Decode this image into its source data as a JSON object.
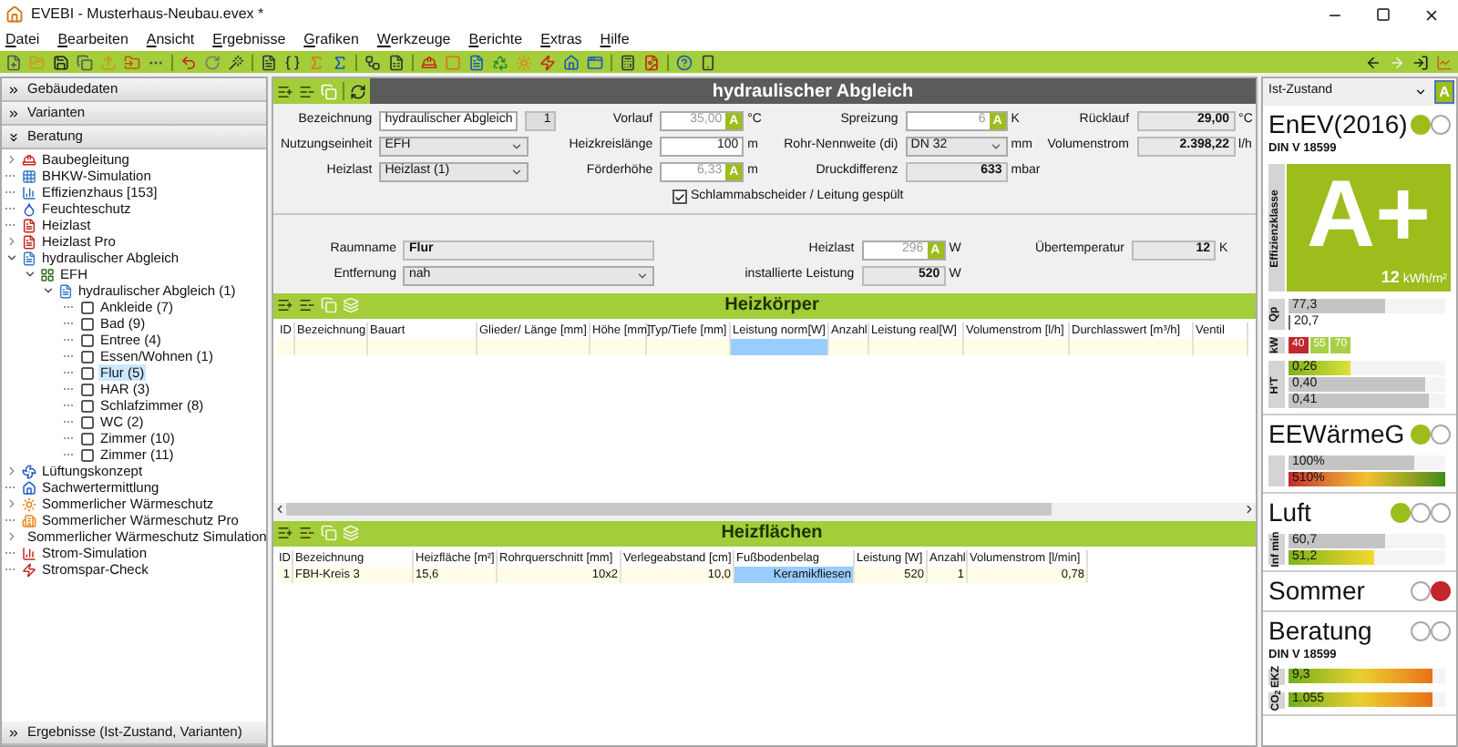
{
  "window": {
    "title": "EVEBI - Musterhaus-Neubau.evex *"
  },
  "menu": [
    "Datei",
    "Bearbeiten",
    "Ansicht",
    "Ergebnisse",
    "Grafiken",
    "Werkzeuge",
    "Berichte",
    "Extras",
    "Hilfe"
  ],
  "sidebar": {
    "sections": [
      {
        "label": "Gebäudedaten",
        "expanded": false
      },
      {
        "label": "Varianten",
        "expanded": false
      },
      {
        "label": "Beratung",
        "expanded": true
      }
    ],
    "tree": [
      {
        "label": "Baubegleitung",
        "kind": "module",
        "expanded": false,
        "selected": false
      },
      {
        "label": "BHKW-Simulation",
        "kind": "module",
        "selected": false
      },
      {
        "label": "Effizienzhaus [153]",
        "kind": "module",
        "selected": false
      },
      {
        "label": "Feuchteschutz",
        "kind": "module",
        "selected": false
      },
      {
        "label": "Heizlast",
        "kind": "module",
        "selected": false
      },
      {
        "label": "Heizlast Pro",
        "kind": "module",
        "expanded": false,
        "selected": false
      },
      {
        "label": "hydraulischer Abgleich",
        "kind": "module",
        "expanded": true,
        "selected": false,
        "children": [
          {
            "label": "EFH",
            "kind": "building",
            "expanded": true,
            "selected": false,
            "children": [
              {
                "label": "hydraulischer Abgleich (1)",
                "kind": "variant",
                "expanded": true,
                "selected": false,
                "children": [
                  {
                    "label": "Ankleide (7)",
                    "kind": "room",
                    "selected": false
                  },
                  {
                    "label": "Bad (9)",
                    "kind": "room",
                    "selected": false
                  },
                  {
                    "label": "Entree (4)",
                    "kind": "room",
                    "selected": false
                  },
                  {
                    "label": "Essen/Wohnen (1)",
                    "kind": "room",
                    "selected": false
                  },
                  {
                    "label": "Flur (5)",
                    "kind": "room",
                    "selected": true
                  },
                  {
                    "label": "HAR (3)",
                    "kind": "room",
                    "selected": false
                  },
                  {
                    "label": "Schlafzimmer (8)",
                    "kind": "room",
                    "selected": false
                  },
                  {
                    "label": "WC (2)",
                    "kind": "room",
                    "selected": false
                  },
                  {
                    "label": "Zimmer (10)",
                    "kind": "room",
                    "selected": false
                  },
                  {
                    "label": "Zimmer (11)",
                    "kind": "room",
                    "selected": false
                  }
                ]
              }
            ]
          }
        ]
      },
      {
        "label": "Lüftungskonzept",
        "kind": "module",
        "expanded": false,
        "selected": false
      },
      {
        "label": "Sachwertermittlung",
        "kind": "module",
        "selected": false
      },
      {
        "label": "Sommerlicher Wärmeschutz",
        "kind": "module",
        "expanded": false,
        "selected": false
      },
      {
        "label": "Sommerlicher Wärmeschutz Pro",
        "kind": "module",
        "selected": false
      },
      {
        "label": "Sommerlicher Wärmeschutz Simulation",
        "kind": "module",
        "expanded": false,
        "selected": false
      },
      {
        "label": "Strom-Simulation",
        "kind": "module",
        "selected": false
      },
      {
        "label": "Stromspar-Check",
        "kind": "module",
        "selected": false
      }
    ],
    "footer": {
      "label": "Ergebnisse (Ist-Zustand, Varianten)",
      "expanded": false
    }
  },
  "main": {
    "title": "hydraulischer Abgleich",
    "form": {
      "rows": [
        [
          {
            "label": "Bezeichnung",
            "kind": "text",
            "value": "hydraulischer Abgleich",
            "extra": "1"
          },
          {
            "label": "Vorlauf",
            "kind": "auto",
            "value": "35,00",
            "badge": "A",
            "unit": "°C"
          },
          {
            "label": "Spreizung",
            "kind": "auto",
            "value": "6",
            "badge": "A",
            "unit": "K"
          },
          {
            "label": "Rücklauf",
            "kind": "readonly",
            "value": "29,00",
            "unit": "°C"
          }
        ],
        [
          {
            "label": "Nutzungseinheit",
            "kind": "select",
            "value": "EFH"
          },
          {
            "label": "Heizkreislänge",
            "kind": "number",
            "value": "100",
            "unit": "m"
          },
          {
            "label": "Rohr-Nennweite (di)",
            "kind": "select",
            "value": "DN 32",
            "unit": "mm"
          },
          {
            "label": "Volumenstrom",
            "kind": "readonly",
            "value": "2.398,22",
            "unit": "l/h"
          }
        ],
        [
          {
            "label": "Heizlast",
            "kind": "select",
            "value": "Heizlast (1)"
          },
          {
            "label": "Förderhöhe",
            "kind": "auto",
            "value": "6,33",
            "badge": "A",
            "unit": "m"
          },
          {
            "label": "Druckdifferenz",
            "kind": "readonly",
            "value": "633",
            "unit": "mbar"
          }
        ]
      ],
      "checkbox": {
        "label": "Schlammabscheider / Leitung gespült",
        "checked": true
      }
    },
    "room": {
      "rows": [
        [
          {
            "label": "Raumname",
            "kind": "name",
            "value": "Flur"
          },
          {
            "label": "Heizlast",
            "kind": "auto",
            "value": "296",
            "badge": "A",
            "unit": "W"
          },
          {
            "label": "Übertemperatur",
            "kind": "readonly",
            "value": "12",
            "unit": "K"
          }
        ],
        [
          {
            "label": "Entfernung",
            "kind": "select",
            "value": "nah"
          },
          {
            "label": "installierte Leistung",
            "kind": "readonly",
            "value": "520",
            "unit": "W"
          }
        ]
      ]
    },
    "tables": [
      {
        "title": "Heizkörper",
        "blank_row": true,
        "columns": [
          {
            "label": "ID",
            "focused": false
          },
          {
            "label": "Bezeichnung",
            "focused": false
          },
          {
            "label": "Bauart",
            "focused": false
          },
          {
            "label": "Glieder/ Länge [mm]",
            "focused": false
          },
          {
            "label": "Höhe [mm]",
            "focused": false
          },
          {
            "label": "Typ/Tiefe [mm]",
            "focused": false
          },
          {
            "label": "Leistung norm[W]",
            "focused": true
          },
          {
            "label": "Anzahl",
            "focused": false
          },
          {
            "label": "Leistung real[W]",
            "focused": false
          },
          {
            "label": "Volumenstrom [l/h]",
            "focused": false
          },
          {
            "label": "Durchlasswert [m³/h]",
            "focused": false
          },
          {
            "label": "Ventil",
            "focused": false
          }
        ]
      },
      {
        "title": "Heizflächen",
        "blank_row": false,
        "columns": [
          {
            "label": "ID",
            "focused": false
          },
          {
            "label": "Bezeichnung",
            "focused": false
          },
          {
            "label": "Heizfläche [m²]",
            "focused": false
          },
          {
            "label": "Rohrquerschnitt [mm]",
            "focused": false
          },
          {
            "label": "Verlegeabstand [cm]",
            "focused": false
          },
          {
            "label": "Fußbodenbelag",
            "focused": true
          },
          {
            "label": "Leistung [W]",
            "focused": false
          },
          {
            "label": "Anzahl",
            "focused": false
          },
          {
            "label": "Volumenstrom [l/min]",
            "focused": false
          }
        ],
        "rows": [
          [
            "1",
            "FBH-Kreis 3",
            "15,6",
            "10x2",
            "10,0",
            "Keramikfliesen",
            "520",
            "1",
            "0,78"
          ]
        ]
      }
    ]
  },
  "right_panel": {
    "scenario": {
      "value": "Ist-Zustand",
      "badge": "A"
    },
    "sections": [
      {
        "title": "EnEV(2016)",
        "subtitle": "DIN V 18599",
        "lights": [
          {
            "on": true,
            "color": "#9cbd1c"
          },
          {
            "on": false
          }
        ],
        "efficiency": {
          "axis_label": "Effizienzklasse",
          "grade": "A+",
          "value": "12",
          "unit": "kWh/m²"
        },
        "groups": [
          {
            "axis_label": "Qp",
            "bars": [
              {
                "value": "77,3",
                "kind": "gray",
                "level": 0.62
              },
              {
                "value": "20,7",
                "kind": "plain"
              }
            ]
          },
          {
            "axis_label": "kW",
            "chips": [
              {
                "value": "40",
                "color": "#c1272d"
              },
              {
                "value": "55",
                "color": "#a9cf45"
              },
              {
                "value": "70",
                "color": "#a9cf45"
              }
            ]
          },
          {
            "axis_label": "H'T",
            "bars": [
              {
                "value": "0,26",
                "kind": "green",
                "level": 0.4
              },
              {
                "value": "0,40",
                "kind": "gray",
                "level": 0.87
              },
              {
                "value": "0,41",
                "kind": "gray",
                "level": 0.9
              }
            ]
          }
        ]
      },
      {
        "title": "EEWärmeG",
        "lights": [
          {
            "on": true,
            "color": "#9cbd1c"
          },
          {
            "on": false
          }
        ],
        "groups": [
          {
            "bars": [
              {
                "value": "100%",
                "kind": "gray",
                "level": 0.8
              },
              {
                "value": "510%",
                "kind": "red_green",
                "level": 1
              }
            ]
          }
        ]
      },
      {
        "title": "Luft",
        "lights": [
          {
            "on": true,
            "color": "#9cbd1c"
          },
          {
            "on": false
          },
          {
            "on": false
          }
        ],
        "groups": [
          {
            "axis_label": "Inf min",
            "bars": [
              {
                "value": "60,7",
                "kind": "gray",
                "level": 0.62
              },
              {
                "value": "51,2",
                "kind": "green_yellow",
                "level": 0.55
              }
            ]
          }
        ]
      },
      {
        "title": "Sommer",
        "lights": [
          {
            "on": false
          },
          {
            "on": true,
            "color": "#c1272d"
          }
        ]
      },
      {
        "title": "Beratung",
        "subtitle": "DIN V 18599",
        "lights": [
          {
            "on": false
          },
          {
            "on": false
          }
        ],
        "groups": [
          {
            "axis_label": "EKZ",
            "bars": [
              {
                "value": "9,3",
                "kind": "green_orange",
                "level": 0.92
              }
            ]
          },
          {
            "axis_label": "CO$_{2}$",
            "bars": [
              {
                "value": "1.055",
                "kind": "green_orange",
                "level": 0.92
              }
            ]
          }
        ]
      }
    ]
  }
}
